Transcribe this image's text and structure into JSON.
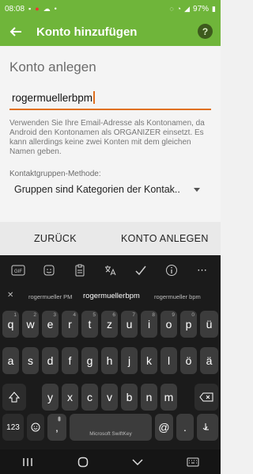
{
  "status_bar": {
    "time": "08:08",
    "battery": "97%"
  },
  "app_bar": {
    "title": "Konto hinzufügen",
    "help_label": "?"
  },
  "form": {
    "heading": "Konto anlegen",
    "account_name": "rogermuellerbpm",
    "hint": "Verwenden Sie Ihre Email-Adresse als Kontonamen, da Android den Kontonamen als ORGANIZER einsetzt. Es kann allerdings keine zwei Konten mit dem gleichen Namen geben.",
    "group_method_label": "Kontaktgruppen-Methode:",
    "group_method_value": "Gruppen sind Kategorien der Kontak.."
  },
  "actions": {
    "back": "ZURÜCK",
    "create": "KONTO ANLEGEN"
  },
  "keyboard": {
    "toolbar": [
      "GIF",
      "sticker",
      "clipboard",
      "translate",
      "check",
      "info",
      "more"
    ],
    "suggestions": [
      "rogermueller PM",
      "rogermuellerbpm",
      "rogermueller bpm"
    ],
    "row1": [
      "q",
      "w",
      "e",
      "r",
      "t",
      "z",
      "u",
      "i",
      "o",
      "p",
      "ü"
    ],
    "row1_sub": [
      "1",
      "2",
      "3",
      "4",
      "5",
      "6",
      "7",
      "8",
      "9",
      "0",
      ""
    ],
    "row2": [
      "a",
      "s",
      "d",
      "f",
      "g",
      "h",
      "j",
      "k",
      "l",
      "ö",
      "ä"
    ],
    "row3": [
      "y",
      "x",
      "c",
      "v",
      "b",
      "n",
      "m"
    ],
    "bottom": {
      "num": "123",
      "comma": ",",
      "space": "Microsoft SwiftKey",
      "at": "@",
      "period": "."
    }
  }
}
